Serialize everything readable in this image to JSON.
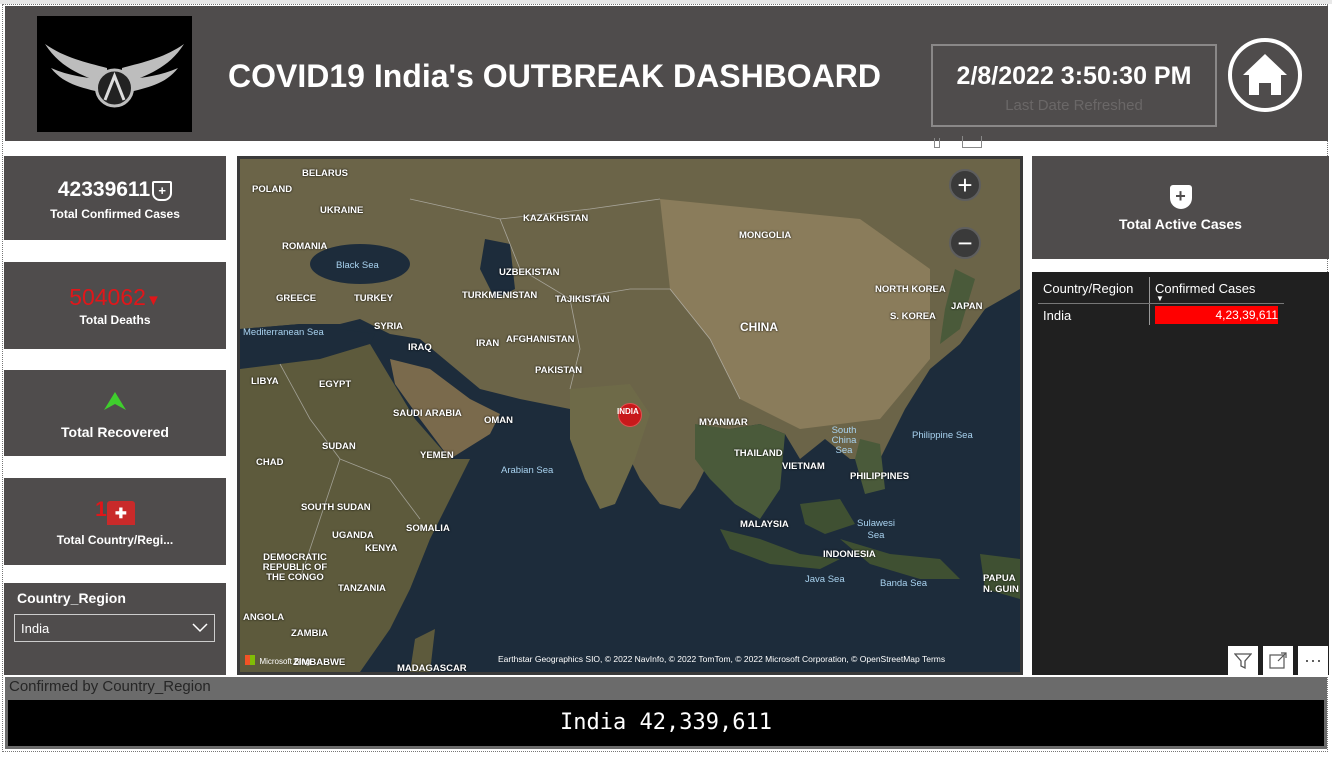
{
  "header": {
    "title": "COVID19 India's OUTBREAK DASHBOARD",
    "date": "2/8/2022 3:50:30 PM",
    "date_label": "Last Date Refreshed"
  },
  "cards": {
    "confirmed_value": "42339611",
    "confirmed_label": "Total Confirmed Cases",
    "deaths_value": "504062",
    "deaths_label": "Total Deaths",
    "recovered_label": "Total Recovered",
    "country_value": "1",
    "country_label": "Total Country/Regi...",
    "active_label": "Total Active Cases"
  },
  "slicer": {
    "title": "Country_Region",
    "selected": "India"
  },
  "map": {
    "labels": [
      {
        "t": "BELARUS",
        "k": "land"
      },
      {
        "t": "POLAND",
        "k": "land"
      },
      {
        "t": "UKRAINE",
        "k": "land"
      },
      {
        "t": "ROMANIA",
        "k": "land"
      },
      {
        "t": "Black Sea",
        "k": "sea"
      },
      {
        "t": "GREECE",
        "k": "land"
      },
      {
        "t": "TURKEY",
        "k": "land"
      },
      {
        "t": "Mediterranean Sea",
        "k": "sea"
      },
      {
        "t": "SYRIA",
        "k": "land"
      },
      {
        "t": "IRAQ",
        "k": "land"
      },
      {
        "t": "LIBYA",
        "k": "land"
      },
      {
        "t": "EGYPT",
        "k": "land"
      },
      {
        "t": "KAZAKHSTAN",
        "k": "land"
      },
      {
        "t": "UZBEKISTAN",
        "k": "land"
      },
      {
        "t": "TURKMENISTAN",
        "k": "land"
      },
      {
        "t": "TAJIKISTAN",
        "k": "land"
      },
      {
        "t": "IRAN",
        "k": "land"
      },
      {
        "t": "AFGHANISTAN",
        "k": "land"
      },
      {
        "t": "PAKISTAN",
        "k": "land"
      },
      {
        "t": "MONGOLIA",
        "k": "land"
      },
      {
        "t": "CHINA",
        "k": "land"
      },
      {
        "t": "NORTH KOREA",
        "k": "land"
      },
      {
        "t": "S. KOREA",
        "k": "land"
      },
      {
        "t": "JAPAN",
        "k": "land"
      },
      {
        "t": "SAUDI ARABIA",
        "k": "land"
      },
      {
        "t": "OMAN",
        "k": "land"
      },
      {
        "t": "YEMEN",
        "k": "land"
      },
      {
        "t": "SUDAN",
        "k": "land"
      },
      {
        "t": "CHAD",
        "k": "land"
      },
      {
        "t": "Arabian Sea",
        "k": "sea"
      },
      {
        "t": "MYANMAR",
        "k": "land"
      },
      {
        "t": "THAILAND",
        "k": "land"
      },
      {
        "t": "VIETNAM",
        "k": "land"
      },
      {
        "t": "South China Sea",
        "k": "sea"
      },
      {
        "t": "Philippine Sea",
        "k": "sea"
      },
      {
        "t": "PHILIPPINES",
        "k": "land"
      },
      {
        "t": "MALAYSIA",
        "k": "land"
      },
      {
        "t": "Sulawesi Sea",
        "k": "sea"
      },
      {
        "t": "INDONESIA",
        "k": "land"
      },
      {
        "t": "Java Sea",
        "k": "sea"
      },
      {
        "t": "Banda Sea",
        "k": "sea"
      },
      {
        "t": "PAPUA N. GUIN",
        "k": "land"
      },
      {
        "t": "SOUTH SUDAN",
        "k": "land"
      },
      {
        "t": "SOMALIA",
        "k": "land"
      },
      {
        "t": "UGANDA",
        "k": "land"
      },
      {
        "t": "KENYA",
        "k": "land"
      },
      {
        "t": "DEMOCRATIC REPUBLIC OF THE CONGO",
        "k": "land"
      },
      {
        "t": "TANZANIA",
        "k": "land"
      },
      {
        "t": "ANGOLA",
        "k": "land"
      },
      {
        "t": "ZAMBIA",
        "k": "land"
      },
      {
        "t": "ZIMBABWE",
        "k": "land"
      },
      {
        "t": "MADAGASCAR",
        "k": "land"
      }
    ],
    "marker_label": "INDIA",
    "bing_label": "Microsoft Bing",
    "attribution": "Earthstar Geographics SIO, © 2022 NavInfo, © 2022 TomTom, © 2022 Microsoft Corporation, © OpenStreetMap  Terms",
    "zoom_in": "+",
    "zoom_out": "−"
  },
  "table": {
    "col1": "Country/Region",
    "col2": "Confirmed Cases",
    "row_country": "India",
    "row_value": "4,23,39,611"
  },
  "bottom": {
    "title": "Confirmed by Country_Region",
    "value": "India 42,339,611"
  },
  "colors": {
    "panel": "#4f4c4c",
    "deaths": "#e0161a",
    "recovered_arrow": "#3fce2d",
    "bar": "#ff0000"
  },
  "icons": [
    "logo-wings-icon",
    "home-icon",
    "shield-plus-icon",
    "down-arrow-icon",
    "up-arrow-icon",
    "hospital-icon",
    "chevron-down-icon",
    "filter-icon",
    "expand-icon",
    "more-options-icon"
  ]
}
